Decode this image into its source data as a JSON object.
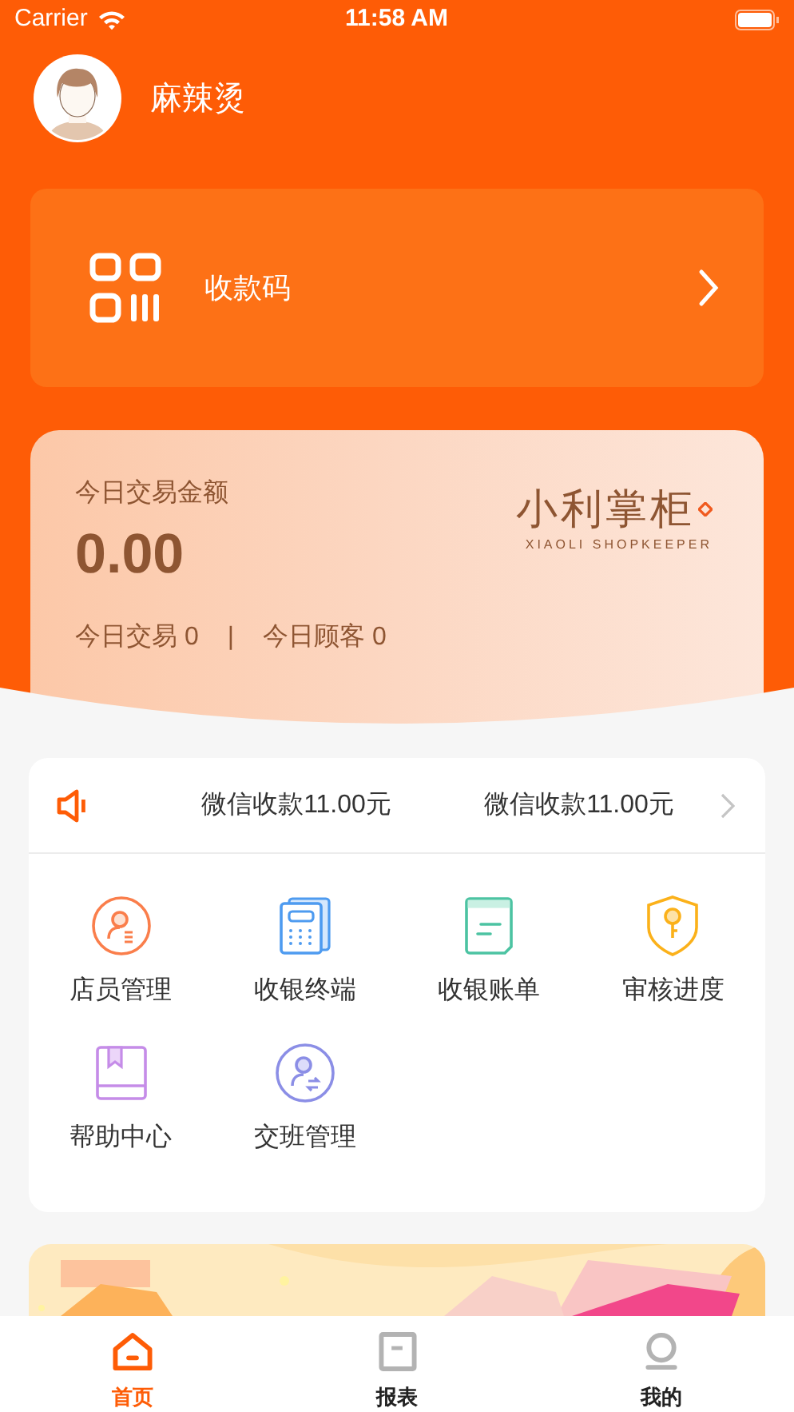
{
  "status_bar": {
    "carrier": "Carrier",
    "time": "11:58 AM"
  },
  "user": {
    "name": "麻辣烫"
  },
  "pay_code": {
    "label": "收款码"
  },
  "today": {
    "title": "今日交易金额",
    "amount": "0.00",
    "trades": "今日交易 0",
    "separator": "|",
    "customers": "今日顾客 0",
    "logo": "小利掌柜",
    "logo_sub": "XIAOLI SHOPKEEPER"
  },
  "notices": [
    "微信收款11.00元",
    "微信收款11.00元"
  ],
  "menu": [
    {
      "kind": "staff",
      "label": "店员管理"
    },
    {
      "kind": "terminal",
      "label": "收银终端"
    },
    {
      "kind": "bill",
      "label": "收银账单"
    },
    {
      "kind": "audit",
      "label": "审核进度"
    },
    {
      "kind": "help",
      "label": "帮助中心"
    },
    {
      "kind": "shift",
      "label": "交班管理"
    }
  ],
  "banner": {
    "kind": "picture"
  },
  "tabs": [
    {
      "kind": "home",
      "label": "首页",
      "selected": true
    },
    {
      "kind": "report",
      "label": "报表",
      "selected": false
    },
    {
      "kind": "mine",
      "label": "我的",
      "selected": false
    }
  ]
}
